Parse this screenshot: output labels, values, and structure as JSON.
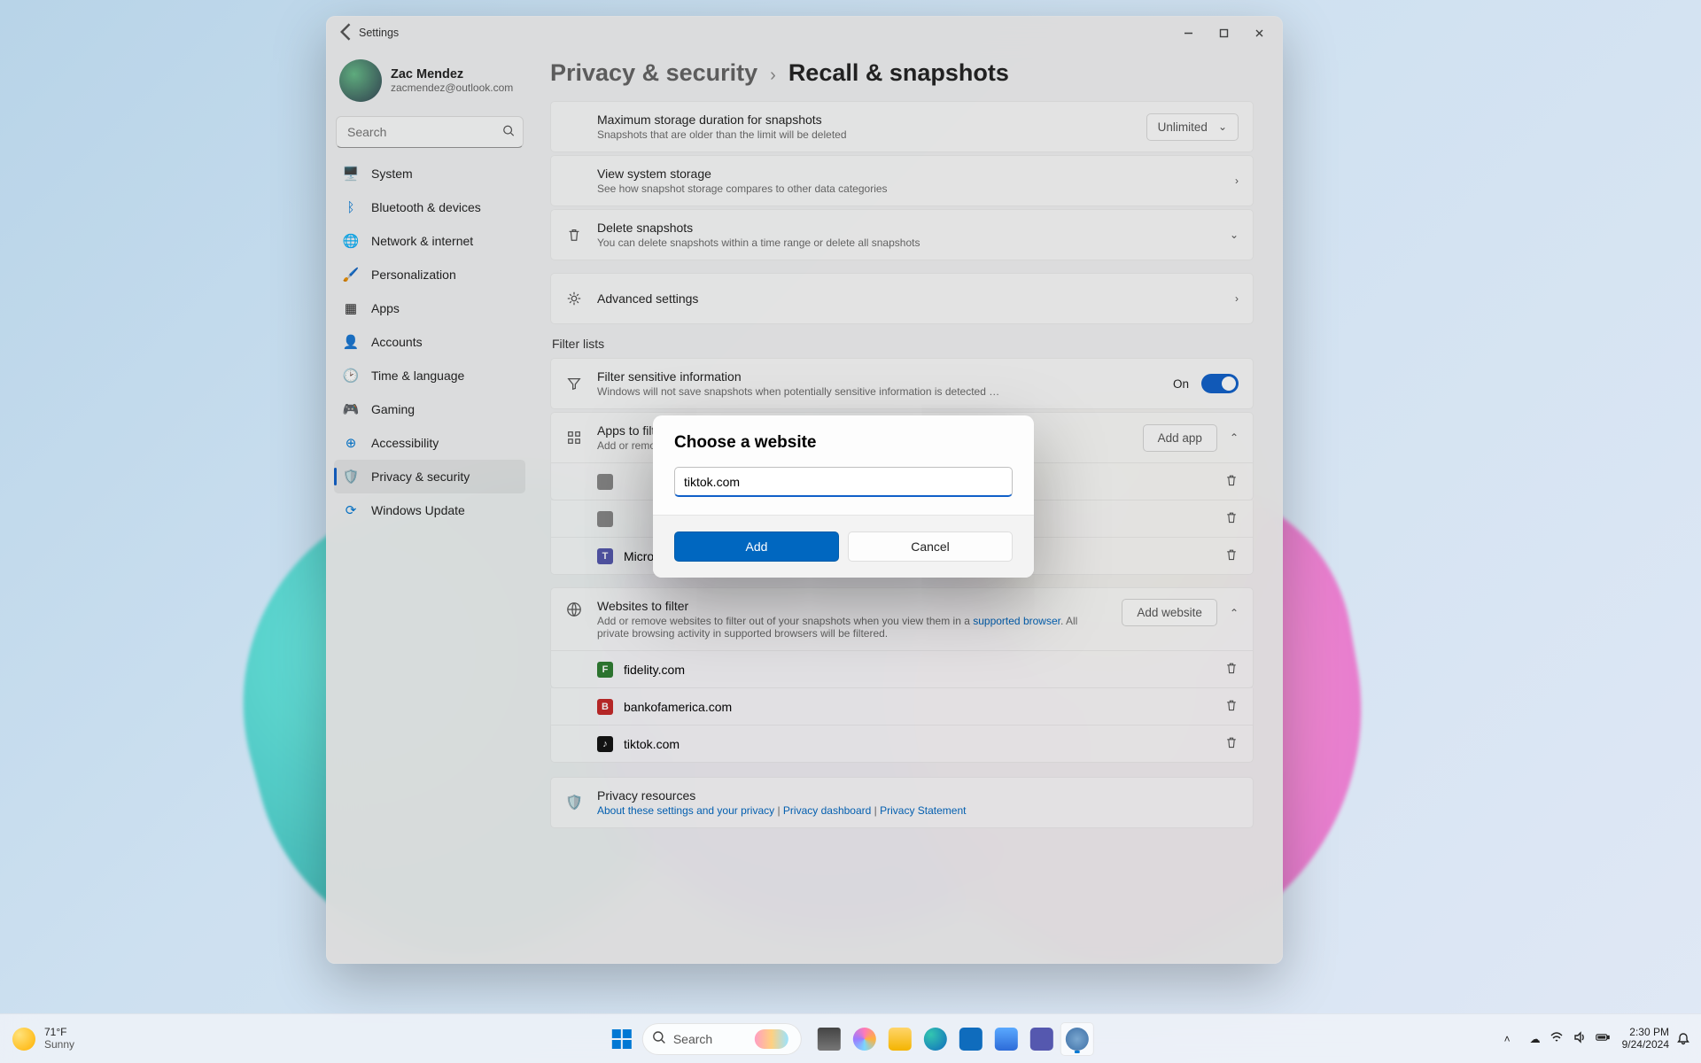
{
  "window": {
    "app_title": "Settings"
  },
  "profile": {
    "name": "Zac Mendez",
    "email": "zacmendez@outlook.com"
  },
  "search": {
    "placeholder": "Search"
  },
  "nav": {
    "system": "System",
    "bluetooth": "Bluetooth & devices",
    "network": "Network & internet",
    "personalization": "Personalization",
    "apps": "Apps",
    "accounts": "Accounts",
    "time": "Time & language",
    "gaming": "Gaming",
    "accessibility": "Accessibility",
    "privacy": "Privacy & security",
    "update": "Windows Update"
  },
  "breadcrumb": {
    "parent": "Privacy & security",
    "current": "Recall & snapshots"
  },
  "storage": {
    "max_title": "Maximum storage duration for snapshots",
    "max_sub": "Snapshots that are older than the limit will be deleted",
    "max_value": "Unlimited",
    "view_title": "View system storage",
    "view_sub": "See how snapshot storage compares to other data categories",
    "delete_title": "Delete snapshots",
    "delete_sub": "You can delete snapshots within a time range or delete all snapshots",
    "advanced": "Advanced settings"
  },
  "filter": {
    "section": "Filter lists",
    "sensitive_title": "Filter sensitive information",
    "sensitive_sub": "Windows will not save snapshots when potentially sensitive information is detected …",
    "toggle_label": "On",
    "apps_title": "Apps to filter",
    "apps_sub": "Add or remove apps to filter out of your snapshots",
    "add_app": "Add app",
    "apps": {
      "teams": "Microsoft Teams"
    },
    "web_title": "Websites to filter",
    "web_sub_a": "Add or remove websites to filter out of your snapshots when you view them in a",
    "web_sub_link": "supported browser",
    "web_sub_b": ". All private browsing activity in supported browsers will be filtered.",
    "add_website": "Add website",
    "sites": {
      "fidelity": "fidelity.com",
      "boa": "bankofamerica.com",
      "tiktok": "tiktok.com"
    }
  },
  "privacy_card": {
    "title": "Privacy resources",
    "link1": "About these settings and your privacy",
    "link2": "Privacy dashboard",
    "link3": "Privacy Statement",
    "sep": " | "
  },
  "modal": {
    "title": "Choose a website",
    "value": "tiktok.com",
    "add": "Add",
    "cancel": "Cancel"
  },
  "taskbar": {
    "temp": "71°F",
    "cond": "Sunny",
    "search_label": "Search",
    "time": "2:30 PM",
    "date": "9/24/2024"
  }
}
